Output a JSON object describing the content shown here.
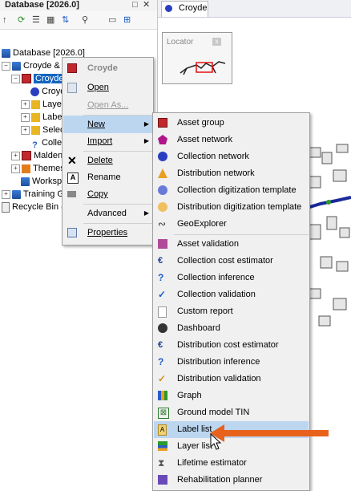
{
  "left_panel": {
    "title": "Database [2026.0]",
    "pin_glyph": "□",
    "close_glyph": "✕",
    "toolbar_icons": [
      "up-arrow-icon",
      "refresh-icon",
      "list-icon",
      "grid-icon",
      "sort-icon",
      "binoculars-icon",
      "window-icon",
      "tree-icon"
    ],
    "tree": [
      {
        "label": "Database [2026.0]",
        "icon": "database-icon"
      },
      {
        "label": "Croyde & N",
        "icon": "database-icon",
        "exp": "−"
      },
      {
        "label": "Croyde",
        "icon": "asset-group-icon",
        "exp": "−",
        "selected": true
      },
      {
        "label": "Croyd",
        "icon": "network-icon"
      },
      {
        "label": "Layer",
        "icon": "layer-icon",
        "exp": "+"
      },
      {
        "label": "Label",
        "icon": "label-icon",
        "exp": "+"
      },
      {
        "label": "Select",
        "icon": "selection-icon",
        "exp": "+"
      },
      {
        "label": "Colle",
        "icon": "inference-icon"
      },
      {
        "label": "Malden",
        "icon": "asset-group-icon",
        "exp": "+"
      },
      {
        "label": "Themes",
        "icon": "themes-icon",
        "exp": "+"
      },
      {
        "label": "Workspa",
        "icon": "workspace-icon"
      },
      {
        "label": "Training Gr",
        "icon": "database-icon",
        "exp": "+"
      },
      {
        "label": "Recycle Bin (*",
        "icon": "recycle-bin-icon"
      }
    ]
  },
  "right_area": {
    "tab_label": "Croyde",
    "locator_title": "Locator",
    "locator_close": "x"
  },
  "context_menu": {
    "header": "Croyde",
    "items": [
      {
        "label": "Open",
        "icon": "open-icon"
      },
      {
        "label": "Open As...",
        "icon": "",
        "disabled": true
      },
      {
        "label": "New",
        "icon": "",
        "submenu": true,
        "highlighted": true
      },
      {
        "label": "Import",
        "icon": "",
        "submenu": true
      },
      {
        "label": "Delete",
        "icon": "delete-icon"
      },
      {
        "label": "Rename",
        "icon": "rename-icon"
      },
      {
        "label": "Copy",
        "icon": "copy-icon"
      },
      {
        "label": "Advanced",
        "icon": "",
        "submenu": true
      },
      {
        "label": "Properties",
        "icon": "properties-icon"
      }
    ]
  },
  "new_submenu": {
    "items": [
      {
        "label": "Asset group",
        "icon": "asset-group-icon"
      },
      {
        "label": "Asset network",
        "icon": "asset-network-icon"
      },
      {
        "label": "Collection network",
        "icon": "collection-network-icon"
      },
      {
        "label": "Distribution network",
        "icon": "distribution-network-icon"
      },
      {
        "label": "Collection digitization template",
        "icon": "collection-template-icon"
      },
      {
        "label": "Distribution digitization template",
        "icon": "distribution-template-icon"
      },
      {
        "label": "GeoExplorer",
        "icon": "geoexplorer-icon"
      },
      {
        "label": "Asset validation",
        "icon": "asset-validation-icon"
      },
      {
        "label": "Collection cost estimator",
        "icon": "cost-estimator-icon"
      },
      {
        "label": "Collection inference",
        "icon": "inference-icon"
      },
      {
        "label": "Collection validation",
        "icon": "validation-icon"
      },
      {
        "label": "Custom report",
        "icon": "report-icon"
      },
      {
        "label": "Dashboard",
        "icon": "dashboard-icon"
      },
      {
        "label": "Distribution cost estimator",
        "icon": "cost-estimator-icon"
      },
      {
        "label": "Distribution inference",
        "icon": "inference-icon"
      },
      {
        "label": "Distribution validation",
        "icon": "validation-icon"
      },
      {
        "label": "Graph",
        "icon": "graph-icon"
      },
      {
        "label": "Ground model TIN",
        "icon": "tin-icon"
      },
      {
        "label": "Label list",
        "icon": "label-list-icon",
        "highlighted": true
      },
      {
        "label": "Layer list",
        "icon": "layer-list-icon"
      },
      {
        "label": "Lifetime estimator",
        "icon": "lifetime-icon"
      },
      {
        "label": "Rehabilitation planner",
        "icon": "rehab-icon"
      }
    ]
  },
  "colors": {
    "selection": "#1565c0",
    "menu_highlight": "#bcd6f0",
    "pointer_arrow": "#e8621c"
  }
}
